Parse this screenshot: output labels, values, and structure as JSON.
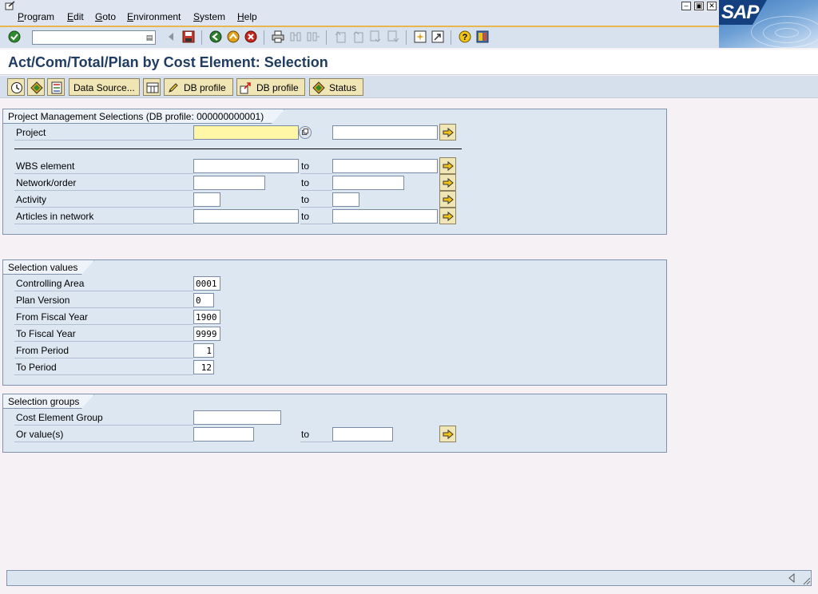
{
  "menu": {
    "items": [
      {
        "key": "P",
        "rest": "rogram"
      },
      {
        "key": "E",
        "rest": "dit"
      },
      {
        "key": "G",
        "rest": "oto"
      },
      {
        "key": "E",
        "rest": "nvironment"
      },
      {
        "key": "S",
        "rest": "ystem"
      },
      {
        "key": "H",
        "rest": "elp"
      }
    ]
  },
  "window_controls": {
    "minimize": "–",
    "restore": "▣",
    "close": "✕"
  },
  "logo": {
    "text": "SAP"
  },
  "std_toolbar": {
    "command_field_value": ""
  },
  "title": "Act/Com/Total/Plan by Cost Element: Selection",
  "app_toolbar": {
    "data_source_label": "Data Source...",
    "db_profile_label_1": "DB profile",
    "db_profile_label_2": "DB profile",
    "status_label": "Status"
  },
  "groups": {
    "project_mgmt": {
      "title": "Project Management Selections (DB profile: 000000000001)",
      "project": {
        "label": "Project",
        "from": "",
        "to": ""
      },
      "wbs": {
        "label": "WBS element",
        "from": "",
        "to_label": "to",
        "to": ""
      },
      "network": {
        "label": "Network/order",
        "from": "",
        "to_label": "to",
        "to": ""
      },
      "activity": {
        "label": "Activity",
        "from": "",
        "to_label": "to",
        "to": ""
      },
      "articles": {
        "label": "Articles in network",
        "from": "",
        "to_label": "to",
        "to": ""
      }
    },
    "selection_values": {
      "title": "Selection values",
      "controlling_area": {
        "label": "Controlling Area",
        "value": "0001"
      },
      "plan_version": {
        "label": "Plan Version",
        "value": "0"
      },
      "from_fiscal_year": {
        "label": "From Fiscal Year",
        "value": "1900"
      },
      "to_fiscal_year": {
        "label": "To Fiscal Year",
        "value": "9999"
      },
      "from_period": {
        "label": "From Period",
        "value": "1"
      },
      "to_period": {
        "label": "To Period",
        "value": "12"
      }
    },
    "selection_groups": {
      "title": "Selection groups",
      "cost_element_group": {
        "label": "Cost Element Group",
        "value": ""
      },
      "or_values": {
        "label": "Or value(s)",
        "from": "",
        "to_label": "to",
        "to": ""
      }
    }
  },
  "status_bar": {
    "text": ""
  },
  "colors": {
    "required_field": "#fff6a6",
    "button_face": "#efe5b5",
    "group_bg": "#dde7f2",
    "title_text": "#1f3c63"
  }
}
